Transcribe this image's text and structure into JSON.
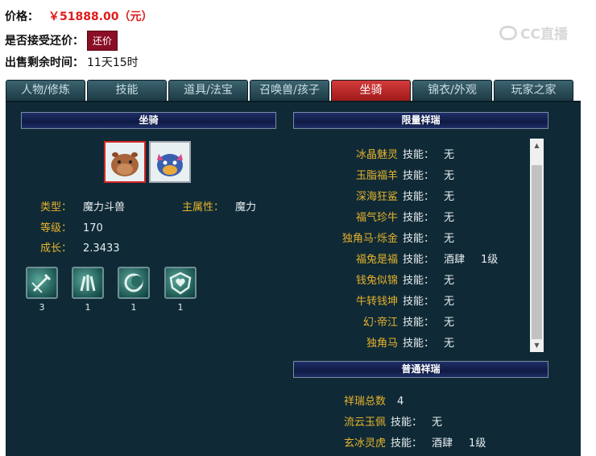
{
  "header": {
    "price_label": "价格：",
    "price_value": "￥51888.00（元）",
    "counter_label": "是否接受还价：",
    "counter_button": "还价",
    "remain_label": "出售剩余时间：",
    "remain_value": "11天15时"
  },
  "watermark": "CC直播",
  "tabs": [
    {
      "label": "人物/修炼"
    },
    {
      "label": "技能"
    },
    {
      "label": "道具/法宝"
    },
    {
      "label": "召唤兽/孩子"
    },
    {
      "label": "坐骑"
    },
    {
      "label": "锦衣/外观"
    },
    {
      "label": "玩家之家"
    }
  ],
  "active_tab": "坐骑",
  "mount": {
    "header": "坐骑",
    "type_label": "类型：",
    "type_value": "魔力斗兽",
    "attr_label": "主属性：",
    "attr_value": "魔力",
    "level_label": "等级：",
    "level_value": "170",
    "growth_label": "成长：",
    "growth_value": "2.3433",
    "skills": [
      {
        "icon": "sword-shield-icon",
        "count": "3"
      },
      {
        "icon": "claw-icon",
        "count": "1"
      },
      {
        "icon": "moon-icon",
        "count": "1"
      },
      {
        "icon": "heart-shield-icon",
        "count": "1"
      }
    ]
  },
  "limited": {
    "header": "限量祥瑞",
    "items": [
      {
        "name": "冰晶魅灵",
        "label": "技能：",
        "value": "无",
        "level": ""
      },
      {
        "name": "玉脂福羊",
        "label": "技能：",
        "value": "无",
        "level": ""
      },
      {
        "name": "深海狂鲨",
        "label": "技能：",
        "value": "无",
        "level": ""
      },
      {
        "name": "福气珍牛",
        "label": "技能：",
        "value": "无",
        "level": ""
      },
      {
        "name": "独角马·烁金",
        "label": "技能：",
        "value": "无",
        "level": ""
      },
      {
        "name": "福兔是福",
        "label": "技能：",
        "value": "酒肆",
        "level": "1级"
      },
      {
        "name": "钱兔似锦",
        "label": "技能：",
        "value": "无",
        "level": ""
      },
      {
        "name": "牛转钱坤",
        "label": "技能：",
        "value": "无",
        "level": ""
      },
      {
        "name": "幻·帝江",
        "label": "技能：",
        "value": "无",
        "level": ""
      },
      {
        "name": "独角马",
        "label": "技能：",
        "value": "无",
        "level": ""
      }
    ]
  },
  "normal": {
    "header": "普通祥瑞",
    "total_label": "祥瑞总数",
    "total_value": "4",
    "items": [
      {
        "name": "流云玉佩",
        "label": "技能：",
        "value": "无",
        "level": ""
      },
      {
        "name": "玄冰灵虎",
        "label": "技能：",
        "value": "酒肆",
        "level": "1级"
      }
    ]
  },
  "colors": {
    "accent_red": "#e01b1b",
    "panel_bg": "#0f2a36",
    "label_gold": "#e6b12c",
    "active_tab": "#c02828"
  }
}
